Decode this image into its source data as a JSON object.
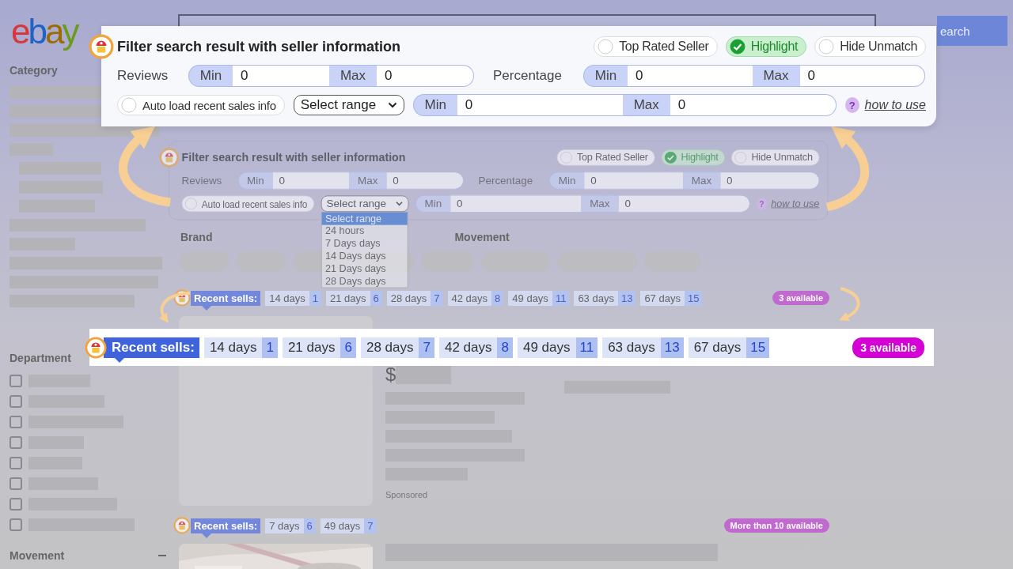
{
  "header": {
    "logo": "ebay",
    "search_button": "earch"
  },
  "sidebar": {
    "category": "Category",
    "department": "Department",
    "department_options": [
      {
        "checked": false
      },
      {
        "checked": false
      },
      {
        "checked": false
      },
      {
        "checked": false
      },
      {
        "checked": false
      },
      {
        "checked": false
      },
      {
        "checked": false
      },
      {
        "checked": false
      }
    ],
    "movement": "Movement"
  },
  "filter_panel": {
    "title": "Filter search result with seller information",
    "toggles": [
      {
        "label": "Top Rated Seller",
        "checked": false
      },
      {
        "label": "Highlight",
        "checked": true
      },
      {
        "label": "Hide Unmatch",
        "checked": false
      }
    ],
    "reviews": {
      "label": "Reviews",
      "min_label": "Min",
      "min": "0",
      "max_label": "Max",
      "max": "0"
    },
    "percentage": {
      "label": "Percentage",
      "min_label": "Min",
      "min": "0",
      "max_label": "Max",
      "max": "0"
    },
    "auto_load": {
      "label": "Auto load recent sales info",
      "checked": false
    },
    "range_select": {
      "value": "Select range",
      "expanded": true,
      "options": [
        {
          "label": "Select range",
          "selected": true
        },
        {
          "label": "24 hours",
          "selected": false
        },
        {
          "label": "7 Days days",
          "selected": false
        },
        {
          "label": "14 Days days",
          "selected": false
        },
        {
          "label": "21 Days days",
          "selected": false
        },
        {
          "label": "28 Days days",
          "selected": false
        }
      ]
    },
    "sales": {
      "min_label": "Min",
      "min": "0",
      "max_label": "Max",
      "max": "0"
    },
    "help": {
      "icon": "?",
      "link": "how to use"
    }
  },
  "refinements": [
    "Brand",
    "Movement"
  ],
  "listings": [
    {
      "recent_sells": {
        "label": "Recent sells:",
        "periods": [
          {
            "period": "14 days",
            "count": "1"
          },
          {
            "period": "21 days",
            "count": "6"
          },
          {
            "period": "28 days",
            "count": "7"
          },
          {
            "period": "42 days",
            "count": "8"
          },
          {
            "period": "49 days",
            "count": "11"
          },
          {
            "period": "63 days",
            "count": "13"
          },
          {
            "period": "67 days",
            "count": "15"
          }
        ]
      },
      "badge": "3 available",
      "price": "$",
      "sponsored": "Sponsored"
    },
    {
      "recent_sells": {
        "label": "Recent sells:",
        "periods": [
          {
            "period": "7 days",
            "count": "6"
          },
          {
            "period": "49 days",
            "count": "7"
          }
        ]
      },
      "badge": "More than 10 available"
    }
  ],
  "callouts": {
    "filter_panel": {
      "title": "Filter search result with seller information",
      "toggles": [
        {
          "label": "Top Rated Seller",
          "checked": false
        },
        {
          "label": "Highlight",
          "checked": true
        },
        {
          "label": "Hide Unmatch",
          "checked": false
        }
      ],
      "reviews": {
        "label": "Reviews",
        "min_label": "Min",
        "min": "0",
        "max_label": "Max",
        "max": "0"
      },
      "percentage": {
        "label": "Percentage",
        "min_label": "Min",
        "min": "0",
        "max_label": "Max",
        "max": "0"
      },
      "auto_load": {
        "label": "Auto load recent sales info",
        "checked": false
      },
      "range_select": {
        "value": "Select range",
        "expanded": false
      },
      "sales": {
        "min_label": "Min",
        "min": "0",
        "max_label": "Max",
        "max": "0"
      },
      "help": {
        "icon": "?",
        "link": "how to use"
      }
    },
    "recent_sells": {
      "label": "Recent sells:",
      "periods": [
        {
          "period": "14 days",
          "count": "1"
        },
        {
          "period": "21 days",
          "count": "6"
        },
        {
          "period": "28 days",
          "count": "7"
        },
        {
          "period": "42 days",
          "count": "8"
        },
        {
          "period": "49 days",
          "count": "11"
        },
        {
          "period": "63 days",
          "count": "13"
        },
        {
          "period": "67 days",
          "count": "15"
        }
      ],
      "badge": "3 available"
    }
  }
}
